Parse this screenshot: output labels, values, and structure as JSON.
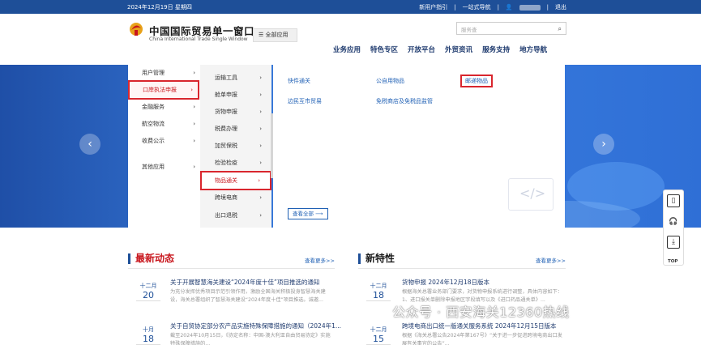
{
  "topbar": {
    "date": "2024年12月19日 星期四",
    "guide": "新用户指引",
    "nav": "一站式导航",
    "sep": "|",
    "logout": "退出"
  },
  "header": {
    "logo_cn": "中国国际贸易单一窗口",
    "logo_en": "China International Trade Single Window",
    "all_apps": "全部应用",
    "search_placeholder": "服务查",
    "nav": [
      "业务应用",
      "特色专区",
      "开放平台",
      "外贸资讯",
      "服务支持",
      "地方导航"
    ]
  },
  "menu": {
    "level1": [
      {
        "label": "用户管理",
        "arrow": "›"
      },
      {
        "label": "口岸执法申报",
        "arrow": "›"
      },
      {
        "label": "金融服务",
        "arrow": "›"
      },
      {
        "label": "航空物流",
        "arrow": "›"
      },
      {
        "label": "收费公示",
        "arrow": "›"
      },
      {
        "label": "其他应用",
        "arrow": "›"
      }
    ],
    "level2": [
      {
        "label": "运输工具",
        "arrow": "›"
      },
      {
        "label": "舱单申报",
        "arrow": "›"
      },
      {
        "label": "货物申报",
        "arrow": "›"
      },
      {
        "label": "税费办理",
        "arrow": "›"
      },
      {
        "label": "加贸保税",
        "arrow": "›"
      },
      {
        "label": "检验检疫",
        "arrow": "›"
      },
      {
        "label": "物品通关",
        "arrow": "›"
      },
      {
        "label": "跨境电商",
        "arrow": "›"
      },
      {
        "label": "出口退税",
        "arrow": "›"
      }
    ],
    "level3": [
      "快件通关",
      "公自用物品",
      "邮递物品",
      "边民互市贸易",
      "免税商店及免税品监管"
    ],
    "view_all": "查看全部"
  },
  "banner": {
    "prev": "‹",
    "next": "›"
  },
  "news": {
    "title": "最新动态",
    "more": "查看更多>>",
    "items": [
      {
        "month": "十二月",
        "day": "20",
        "title": "关于开展智慧海关建设“2024年度十佳”项目推选的通知",
        "summary": "为充分发挥优秀项目示范引领作用，激励全国海关积极投身智慧海关建设，海关总署组织了智慧海关建设“2024年度十佳”项目推选。诚邀..."
      },
      {
        "month": "十月",
        "day": "18",
        "title": "关于自贸协定部分农产品实施特殊保障措施的通知（2024年1...",
        "summary": "截至2024年10月15日，《协定名称：中国-澳大利亚自由贸易协定》实施特殊保障措施的..."
      }
    ]
  },
  "features": {
    "title": "新特性",
    "more": "查看更多>>",
    "items": [
      {
        "month": "十二月",
        "day": "18",
        "title": "货物申报 2024年12月18日版本",
        "summary": "根据海关总署业务部门要求，对货物申报系统进行调整，具体内容如下：1、进口报关单删除申报地区字段填写以及《进口药品通关单》..."
      },
      {
        "month": "十二月",
        "day": "15",
        "title": "跨境电商出口统一版通关服务系统 2024年12月15日版本",
        "summary": "根据《海关总署公告2024年第167号》“关于进一步促进跨境电商出口发展有关事宜的公告”..."
      }
    ]
  },
  "sidebar": {
    "top_label": "TOP"
  },
  "watermark": "公众号 · 西安海关12360热线"
}
